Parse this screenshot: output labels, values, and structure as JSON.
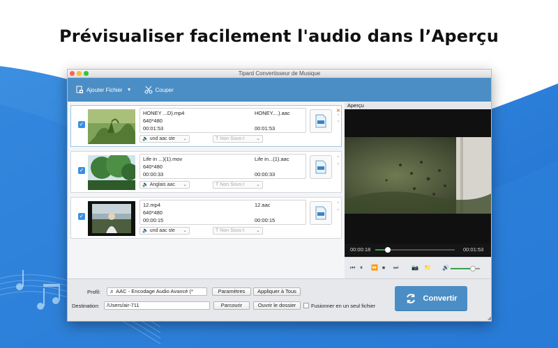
{
  "headline": "Prévisualiser facilement l'audio dans l’Aperçu",
  "window": {
    "title": "Tipard Convertisseur de Musique"
  },
  "toolbar": {
    "add_file_label": "Ajouter Fichier",
    "cut_label": "Couper"
  },
  "files": [
    {
      "source_name": "HONEY ...D).mp4",
      "resolution": "640*480",
      "source_duration": "00:01:53",
      "output_name": "HONEY....).aac",
      "output_duration": "00:01:53",
      "audio_track": "und aac ste",
      "subtitle": "Non Sous-t",
      "checked": true
    },
    {
      "source_name": "Life in ...)(1).mov",
      "resolution": "640*480",
      "source_duration": "00:00:33",
      "output_name": "Life in...(1).aac",
      "output_duration": "00:00:33",
      "audio_track": "Anglais aac",
      "subtitle": "Non Sous-t",
      "checked": true
    },
    {
      "source_name": "12.mp4",
      "resolution": "640*480",
      "source_duration": "00:00:15",
      "output_name": "12.aac",
      "output_duration": "00:00:15",
      "audio_track": "und aac ste",
      "subtitle": "Non Sous-t",
      "checked": true
    }
  ],
  "preview": {
    "label": "Aperçu",
    "current_time": "00:00:18",
    "total_time": "00:01:53",
    "progress_fraction": 0.16,
    "volume_fraction": 0.75
  },
  "bottom": {
    "profile_label": "Profil:",
    "profile_value": "AAC - Encodage Audio Avancé (*",
    "settings_button": "Paramètres",
    "apply_all_button": "Appliquer à Tous",
    "destination_label": "Destination:",
    "destination_value": "/Users/air-711",
    "browse_button": "Parcourir",
    "open_folder_button": "Ouvrir le dossier",
    "merge_label": "Fusionner en un seul fichier",
    "merge_checked": false,
    "convert_button": "Convertir"
  },
  "colors": {
    "accent": "#4b8ec6",
    "progress": "#38a34a",
    "checkbox": "#3a8fe0"
  }
}
